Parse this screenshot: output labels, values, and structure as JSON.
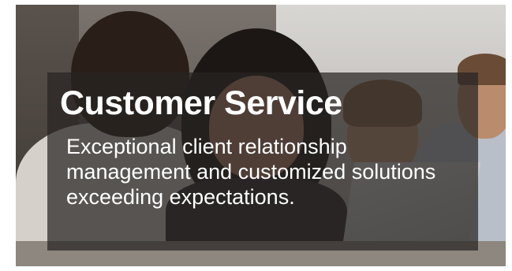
{
  "hero": {
    "title": "Customer Service",
    "description": "Exceptional client relationship management and customized solutions exceeding expectations.",
    "image": "team-working-at-laptops-photo",
    "overlay_color": "#282422"
  }
}
